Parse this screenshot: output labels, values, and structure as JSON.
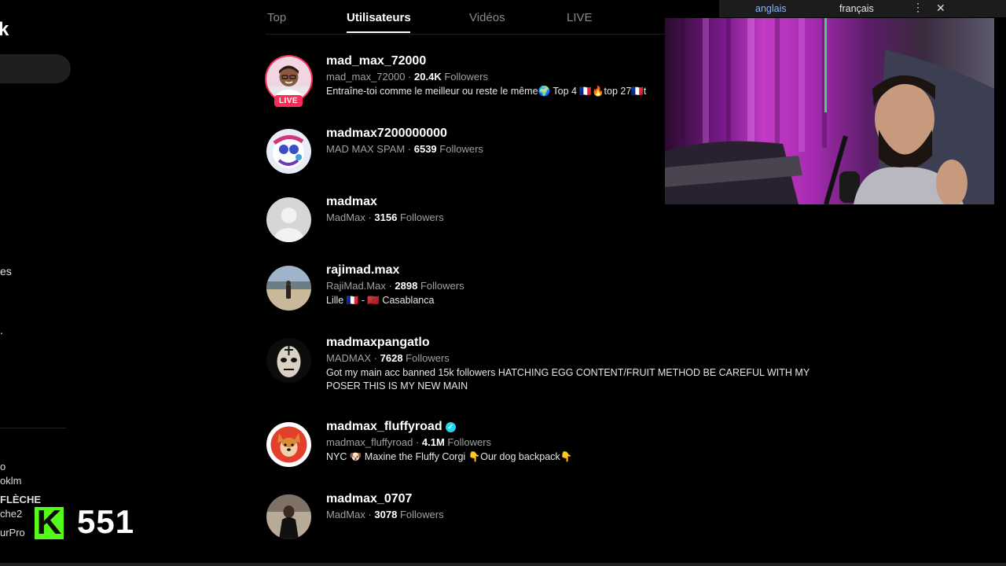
{
  "sidebar": {
    "logo_fragment": "k",
    "frag_es": "es",
    "frag_dot": ".",
    "chat_lines": [
      "o",
      "oklm",
      "FLÈCHE",
      "che2",
      "urPro"
    ],
    "kick_letter": "K",
    "kick_viewers": "551"
  },
  "tabs": [
    {
      "label": "Top"
    },
    {
      "label": "Utilisateurs"
    },
    {
      "label": "Vidéos"
    },
    {
      "label": "LIVE"
    }
  ],
  "live_badge": "LIVE",
  "results": [
    {
      "username": "mad_max_72000",
      "display_name": "mad_max_72000",
      "followers": "20.4K",
      "followers_label": "Followers",
      "bio": "Entraîne-toi comme le meilleur ou reste le même🌍 Top 4 🇫🇷🔥top 27🇫🇷t"
    },
    {
      "username": "madmax7200000000",
      "display_name": "MAD MAX SPAM",
      "followers": "6539",
      "followers_label": "Followers",
      "bio": ""
    },
    {
      "username": "madmax",
      "display_name": "MadMax",
      "followers": "3156",
      "followers_label": "Followers",
      "bio": ""
    },
    {
      "username": "rajimad.max",
      "display_name": "RajiMad.Max",
      "followers": "2898",
      "followers_label": "Followers",
      "bio": "Lille 🇫🇷 - 🇲🇦 Casablanca"
    },
    {
      "username": "madmaxpangatlo",
      "display_name": "MADMAX",
      "followers": "7628",
      "followers_label": "Followers",
      "bio": "Got my main acc banned 15k followers HATCHING EGG CONTENT/FRUIT METHOD BE CAREFUL WITH MY POSER THIS IS MY NEW MAIN"
    },
    {
      "username": "madmax_fluffyroad",
      "display_name": "madmax_fluffyroad",
      "followers": "4.1M",
      "followers_label": "Followers",
      "bio": "NYC 🐶 Maxine the Fluffy Corgi 👇Our dog backpack👇"
    },
    {
      "username": "madmax_0707",
      "display_name": "MadMax",
      "followers": "3078",
      "followers_label": "Followers",
      "bio": ""
    }
  ],
  "translate_bar": {
    "source": "anglais",
    "target": "français",
    "menu_icon": "⋮",
    "close_icon": "✕"
  },
  "colors": {
    "accent": "#fe2c55",
    "verified": "#20d5ec",
    "kick": "#53fc18"
  }
}
